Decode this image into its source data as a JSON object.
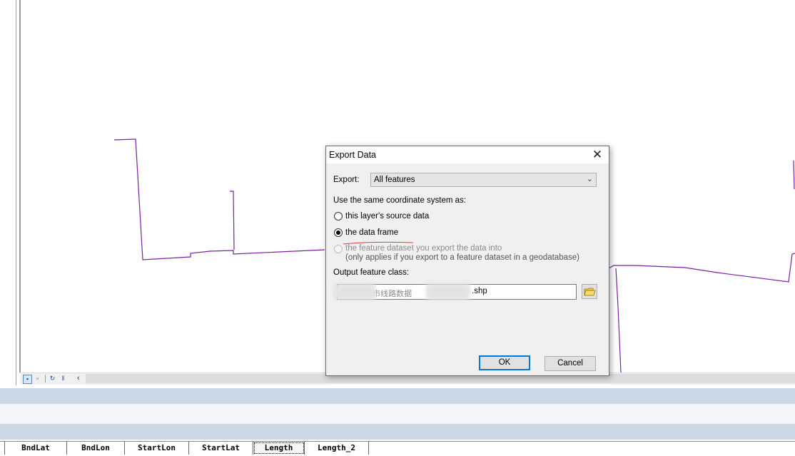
{
  "dialog": {
    "title": "Export Data",
    "export_label": "Export:",
    "export_value": "All features",
    "coordinate_heading": "Use the same coordinate system as:",
    "radio_options": [
      {
        "label": "this layer's source data",
        "checked": false,
        "enabled": true
      },
      {
        "label": "the data frame",
        "checked": true,
        "enabled": true
      },
      {
        "label": "the feature dataset you export the data into",
        "checked": false,
        "enabled": false
      }
    ],
    "radio_note": "(only applies if you export to a feature dataset in a geodatabase)",
    "output_label": "Output feature class:",
    "output_value": ".shp",
    "output_obscured_text": "...市线路数据",
    "ok_label": "OK",
    "cancel_label": "Cancel"
  },
  "attribute_table": {
    "columns": [
      "BndLat",
      "BndLon",
      "StartLon",
      "StartLat",
      "Length",
      "Length_2"
    ],
    "selected_column": "Length"
  },
  "colors": {
    "feature_line": "#7b1fa2",
    "annotation_underline": "#e53935",
    "default_button_border": "#0078d7"
  },
  "icons": [
    "close-icon",
    "chevron-down-icon",
    "folder-open-icon",
    "layout-view-icon",
    "data-view-icon",
    "refresh-icon",
    "pause-icon",
    "scroll-left-icon"
  ]
}
